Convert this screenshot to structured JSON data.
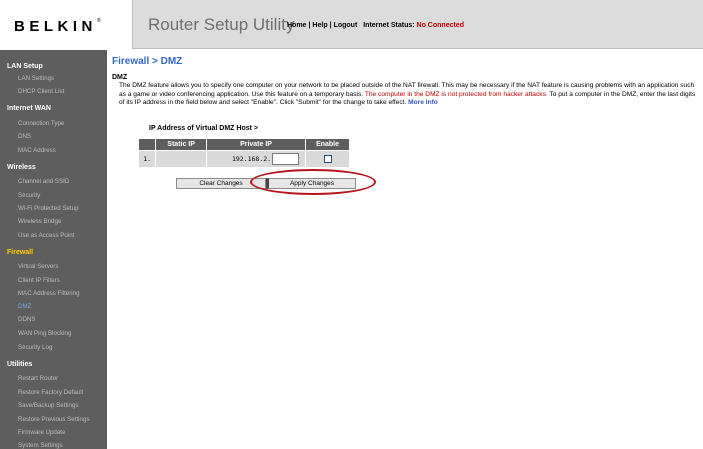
{
  "header": {
    "logo": "BELKIN",
    "logo_mark": "®",
    "app_title": "Router Setup Utility",
    "links": [
      "Home",
      "Help",
      "Logout"
    ],
    "status_label": "Internet Status:",
    "status_value": "No Connected",
    "status_color": "#c00000"
  },
  "sidebar": {
    "sections": [
      {
        "title": "LAN Setup",
        "items": [
          "LAN Settings",
          "DHCP Client List"
        ]
      },
      {
        "title": "Internet WAN",
        "items": [
          "Connection Type",
          "DNS",
          "MAC Address"
        ]
      },
      {
        "title": "Wireless",
        "items": [
          "Channel and SSID",
          "Security",
          "Wi-Fi Protected Setup",
          "Wireless Bridge",
          "Use as Access Point"
        ]
      },
      {
        "title": "Firewall",
        "items": [
          "Virtual Servers",
          "Client IP Filters",
          "MAC Address Filtering",
          "DMZ",
          "DDNS",
          "WAN Ping Blocking",
          "Security Log"
        ]
      },
      {
        "title": "Utilities",
        "items": [
          "Restart Router",
          "Restore Factory Default",
          "Save/Backup Settings",
          "Restore Previous Settings",
          "Firmware Update",
          "System Settings"
        ]
      }
    ],
    "active_section": "Firewall",
    "current_item": "DMZ"
  },
  "main": {
    "page_title": "Firewall > DMZ",
    "section_label": "DMZ",
    "description": "The DMZ feature allows you to specify one computer on your network to be placed outside of the NAT firewall. This may be necessary if the NAT feature is causing problems with an application such as a game or video conferencing application. Use this feature on a temporary basis. ",
    "warning": "The computer in the DMZ is not protected from hacker attacks.",
    "description_tail": " To put a computer in the DMZ, enter the last digits of its IP address in the field below and select \"Enable\". Click \"Submit\" for the change to take effect. ",
    "more_info": "More Info",
    "host_label": "IP Address of Virtual DMZ Host >",
    "table": {
      "headers": [
        "Static IP",
        "Private IP",
        "Enable"
      ],
      "rows": [
        {
          "num": "1.",
          "static_ip": "",
          "private_prefix": "192.168.2.",
          "private_value": "",
          "enabled": false
        }
      ]
    },
    "buttons": {
      "clear": "Clear Changes",
      "apply": "Apply Changes"
    },
    "highlight_color": "#b5141a"
  }
}
